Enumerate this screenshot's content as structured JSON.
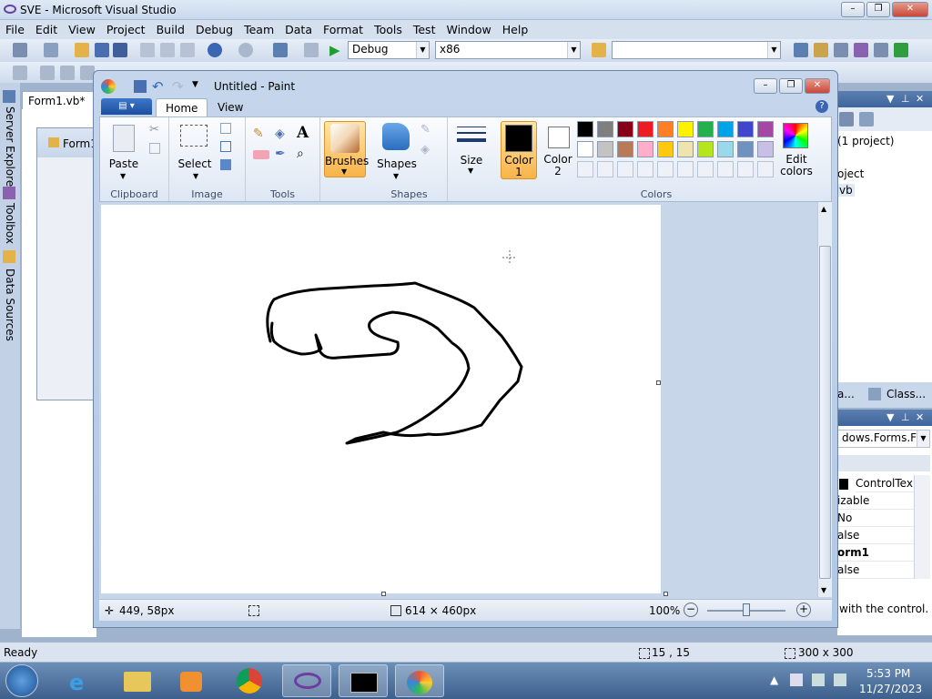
{
  "vs": {
    "title": "SVE - Microsoft Visual Studio",
    "menu": [
      "File",
      "Edit",
      "View",
      "Project",
      "Build",
      "Debug",
      "Team",
      "Data",
      "Format",
      "Tools",
      "Test",
      "Window",
      "Help"
    ],
    "toolbar": {
      "config": "Debug",
      "platform": "x86",
      "search": ""
    },
    "side_tabs": [
      "Server Explorer",
      "Toolbox",
      "Data Sources"
    ],
    "doc_tab": "Form1.vb*",
    "form_title": "Form1",
    "solution": {
      "line1": "(1 project)",
      "line2": "oject",
      "line3": "vb"
    },
    "class_tabs": {
      "left": "a...",
      "right": "Class..."
    },
    "properties": {
      "object": "dows.Forms.Fo",
      "rows": [
        "ControlTex",
        "izable",
        "No",
        "alse",
        "orm1",
        "alse"
      ],
      "desc": "with the control."
    },
    "status": {
      "left": "Ready",
      "pos": "15 , 15",
      "size": "300 x 300"
    }
  },
  "paint": {
    "title": "Untitled - Paint",
    "tabs": {
      "home": "Home",
      "view": "View"
    },
    "groups": {
      "clipboard": "Clipboard",
      "image": "Image",
      "tools": "Tools",
      "shapes": "Shapes",
      "colors": "Colors"
    },
    "buttons": {
      "paste": "Paste",
      "select": "Select",
      "brushes": "Brushes",
      "shapes": "Shapes",
      "size": "Size",
      "color1": "Color 1",
      "color2": "Color 2",
      "edit_colors": "Edit colors"
    },
    "palette_row1": [
      "#000000",
      "#7f7f7f",
      "#880015",
      "#ed1c24",
      "#ff7f27",
      "#fff200",
      "#22b14c",
      "#00a2e8",
      "#3f48cc",
      "#a349a4"
    ],
    "palette_row2": [
      "#ffffff",
      "#c3c3c3",
      "#b97a57",
      "#ffaec9",
      "#ffc90e",
      "#efe4b0",
      "#b5e61d",
      "#99d9ea",
      "#7092be",
      "#c8bfe7"
    ],
    "color1": "#000000",
    "color2": "#ffffff",
    "status": {
      "cursor": "449, 58px",
      "selection": "",
      "canvas_size": "614 × 460px",
      "zoom": "100%"
    }
  },
  "taskbar": {
    "time": "5:53 PM",
    "date": "11/27/2023"
  }
}
